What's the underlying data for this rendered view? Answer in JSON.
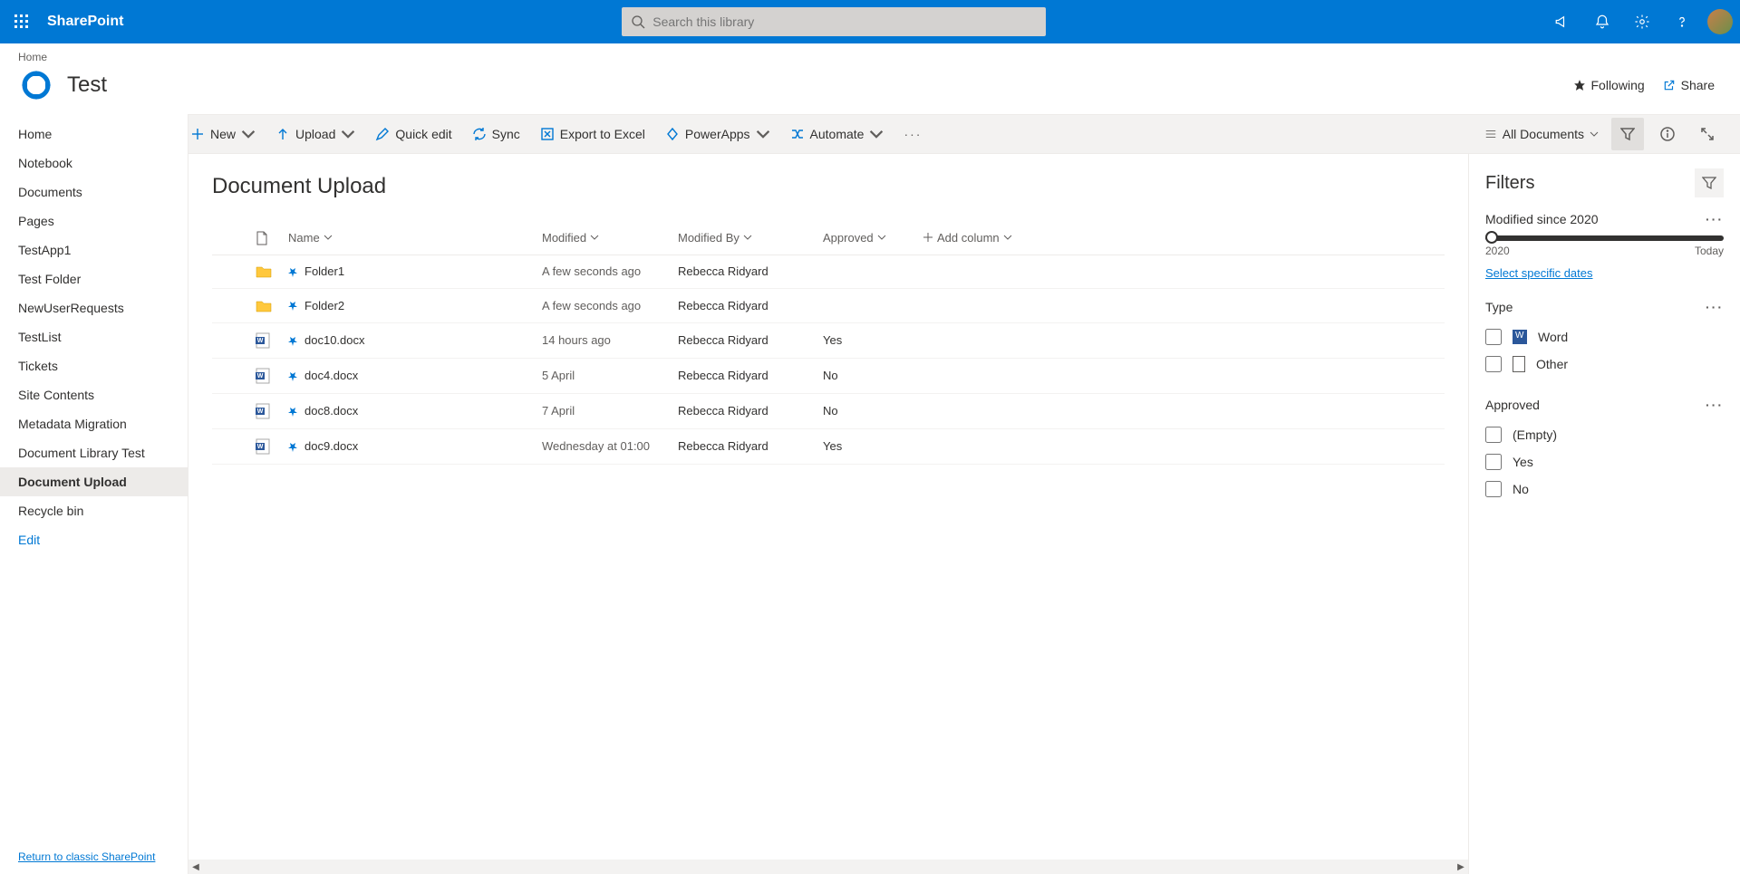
{
  "brand": "SharePoint",
  "search": {
    "placeholder": "Search this library"
  },
  "breadcrumb": "Home",
  "site_title": "Test",
  "site_actions": {
    "following": "Following",
    "share": "Share"
  },
  "cmdbar": {
    "new": "New",
    "upload": "Upload",
    "quick_edit": "Quick edit",
    "sync": "Sync",
    "export": "Export to Excel",
    "powerapps": "PowerApps",
    "automate": "Automate",
    "view": "All Documents"
  },
  "leftnav": {
    "items": [
      "Home",
      "Notebook",
      "Documents",
      "Pages",
      "TestApp1",
      "Test Folder",
      "NewUserRequests",
      "TestList",
      "Tickets",
      "Site Contents",
      "Metadata Migration",
      "Document Library Test",
      "Document Upload",
      "Recycle bin"
    ],
    "edit": "Edit",
    "classic": "Return to classic SharePoint"
  },
  "page_title": "Document Upload",
  "columns": {
    "name": "Name",
    "modified": "Modified",
    "modified_by": "Modified By",
    "approved": "Approved",
    "add": "Add column"
  },
  "rows": [
    {
      "type": "folder",
      "name": "Folder1",
      "modified": "A few seconds ago",
      "modified_by": "Rebecca Ridyard",
      "approved": ""
    },
    {
      "type": "folder",
      "name": "Folder2",
      "modified": "A few seconds ago",
      "modified_by": "Rebecca Ridyard",
      "approved": ""
    },
    {
      "type": "docx",
      "name": "doc10.docx",
      "modified": "14 hours ago",
      "modified_by": "Rebecca Ridyard",
      "approved": "Yes"
    },
    {
      "type": "docx",
      "name": "doc4.docx",
      "modified": "5 April",
      "modified_by": "Rebecca Ridyard",
      "approved": "No"
    },
    {
      "type": "docx",
      "name": "doc8.docx",
      "modified": "7 April",
      "modified_by": "Rebecca Ridyard",
      "approved": "No"
    },
    {
      "type": "docx",
      "name": "doc9.docx",
      "modified": "Wednesday at 01:00",
      "modified_by": "Rebecca Ridyard",
      "approved": "Yes"
    }
  ],
  "filters": {
    "title": "Filters",
    "modified_since": {
      "label": "Modified since 2020",
      "from": "2020",
      "to": "Today",
      "link": "Select specific dates"
    },
    "type": {
      "label": "Type",
      "options": [
        "Word",
        "Other"
      ]
    },
    "approved": {
      "label": "Approved",
      "options": [
        "(Empty)",
        "Yes",
        "No"
      ]
    }
  }
}
